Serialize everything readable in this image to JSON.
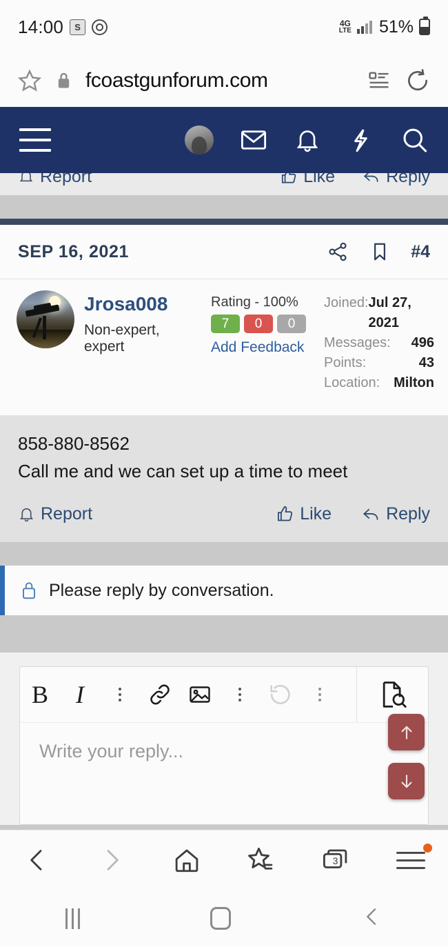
{
  "status_bar": {
    "time": "14:00",
    "app_icon_1": "s-badge-icon",
    "app_icon_2": "target-icon",
    "network": "4G",
    "network_sub": "LTE",
    "battery_percent": "51%"
  },
  "browser": {
    "url": "fcoastgunforum.com",
    "star_icon": "star-outline-icon",
    "lock_icon": "lock-icon",
    "reader_icon": "reader-mode-icon",
    "reload_icon": "reload-icon",
    "bottom_nav": {
      "back_icon": "chevron-left-icon",
      "forward_icon": "chevron-right-icon",
      "home_icon": "home-icon",
      "bookmarks_icon": "bookmarks-star-icon",
      "tabs_icon": "tabs-icon",
      "tabs_count": "3",
      "menu_icon": "menu-icon",
      "menu_badge": "update-dot"
    }
  },
  "forum_nav": {
    "menu_icon": "hamburger-menu-icon",
    "avatar_icon": "user-avatar-icon",
    "inbox_icon": "envelope-icon",
    "alerts_icon": "bell-icon",
    "whats_new_icon": "lightning-bolt-icon",
    "search_icon": "search-icon"
  },
  "previous_post_footer": {
    "report_label": "Report",
    "report_icon": "bell-report-icon",
    "like_label": "Like",
    "like_icon": "thumbs-up-icon",
    "reply_label": "Reply",
    "reply_icon": "reply-arrow-icon"
  },
  "post": {
    "date": "SEP 16, 2021",
    "share_icon": "share-icon",
    "bookmark_icon": "bookmark-icon",
    "post_number": "#4",
    "author": {
      "name": "Jrosa008",
      "title": "Non-expert, expert",
      "avatar_icon": "rifle-silhouette-avatar"
    },
    "rating": {
      "label": "Rating - 100%",
      "positive": "7",
      "negative": "0",
      "neutral": "0",
      "add_feedback_label": "Add Feedback",
      "positive_color": "#6fb04a",
      "negative_color": "#d9534f",
      "neutral_color": "#a8a8a8"
    },
    "stats": [
      {
        "key": "Joined:",
        "value": "Jul 27, 2021"
      },
      {
        "key": "Messages:",
        "value": "496"
      },
      {
        "key": "Points:",
        "value": "43"
      },
      {
        "key": "Location:",
        "value": "Milton"
      }
    ],
    "body": {
      "line1": "858-880-8562",
      "line2": "Call me and we can set up a time to meet"
    },
    "footer": {
      "report_label": "Report",
      "report_icon": "bell-report-icon",
      "like_label": "Like",
      "like_icon": "thumbs-up-icon",
      "reply_label": "Reply",
      "reply_icon": "reply-arrow-icon"
    }
  },
  "notice": {
    "lock_icon": "lock-closed-icon",
    "text": "Please reply by conversation.",
    "accent_color": "#2f69b3"
  },
  "editor": {
    "bold_label": "B",
    "italic_label": "I",
    "more_icon_1": "kebab-menu-icon",
    "link_icon": "link-icon",
    "image_icon": "image-icon",
    "more_icon_2": "kebab-menu-icon",
    "undo_icon": "undo-icon",
    "more_icon_3": "kebab-menu-icon",
    "preview_icon": "preview-document-icon",
    "placeholder": "Write your reply..."
  },
  "scroll_buttons": {
    "up_icon": "arrow-up-icon",
    "down_icon": "arrow-down-icon",
    "color": "#9d4b4b"
  },
  "android_nav": {
    "recents_icon": "recents-icon",
    "home_icon": "home-square-icon",
    "back_icon": "back-chevron-icon"
  }
}
